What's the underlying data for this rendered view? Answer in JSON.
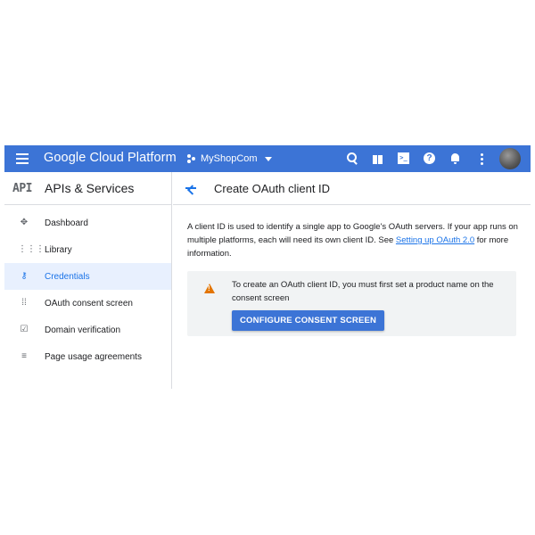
{
  "topbar": {
    "brand": "Google Cloud Platform",
    "project_name": "MyShopCom",
    "icons": [
      "menu-icon",
      "search-icon",
      "gift-icon",
      "cloud-shell-icon",
      "help-icon",
      "notifications-icon",
      "more-vert-icon"
    ],
    "accent_color": "#3c74d6"
  },
  "sidebar": {
    "logo": "API",
    "title": "APIs & Services",
    "items": [
      {
        "label": "Dashboard",
        "icon": "dashboard-icon",
        "active": false
      },
      {
        "label": "Library",
        "icon": "library-icon",
        "active": false
      },
      {
        "label": "Credentials",
        "icon": "key-icon",
        "active": true
      },
      {
        "label": "OAuth consent screen",
        "icon": "consent-icon",
        "active": false
      },
      {
        "label": "Domain verification",
        "icon": "checkbox-icon",
        "active": false
      },
      {
        "label": "Page usage agreements",
        "icon": "settings-list-icon",
        "active": false
      }
    ]
  },
  "main": {
    "title": "Create OAuth client ID",
    "description_pre": "A client ID is used to identify a single app to Google's OAuth servers. If your app runs on multiple platforms, each will need its own client ID. See ",
    "description_link": "Setting up OAuth 2.0",
    "description_post": " for more information.",
    "notice": {
      "icon": "warning-icon",
      "text": "To create an OAuth client ID, you must first set a product name on the consent screen",
      "button_label": "CONFIGURE CONSENT SCREEN"
    }
  }
}
